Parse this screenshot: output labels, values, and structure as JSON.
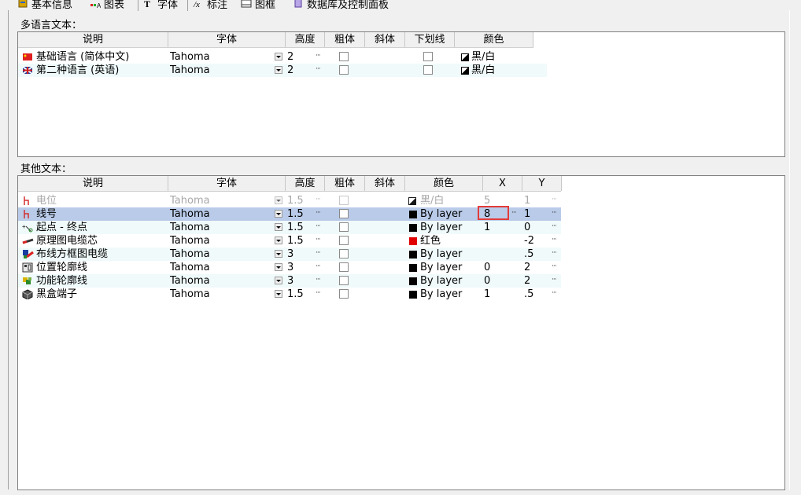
{
  "toolbar": {
    "items": [
      {
        "label": "基本信息",
        "icon": "basic-info-icon"
      },
      {
        "label": "图表",
        "icon": "chart-icon"
      },
      {
        "label": "字体",
        "icon": "font-icon"
      },
      {
        "label": "标注",
        "icon": "annotation-icon"
      },
      {
        "label": "图框",
        "icon": "frame-icon"
      },
      {
        "label": "数据库及控制面板",
        "icon": "database-icon"
      }
    ]
  },
  "multilang": {
    "section_title": "多语言文本：",
    "headers": [
      "说明",
      "字体",
      "高度",
      "粗体",
      "斜体",
      "下划线",
      "颜色"
    ],
    "rows": [
      {
        "desc": "基础语言 (简体中文)",
        "icon": "flag-china-icon",
        "font": "Tahoma",
        "height": "2",
        "color": "黑/白"
      },
      {
        "desc": "第二种语言 (英语)",
        "icon": "flag-uk-icon",
        "font": "Tahoma",
        "height": "2",
        "color": "黑/白"
      }
    ]
  },
  "other": {
    "section_title": "其他文本：",
    "headers": [
      "说明",
      "字体",
      "高度",
      "粗体",
      "斜体",
      "颜色",
      "X",
      "Y"
    ],
    "rows": [
      {
        "desc": "电位",
        "icon": "potential-icon",
        "font": "Tahoma",
        "height": "1.5",
        "color": "黑/白",
        "x": "5",
        "y": "1",
        "disabled": true
      },
      {
        "desc": "线号",
        "icon": "wire-number-icon",
        "font": "Tahoma",
        "height": "1.5",
        "color": "By layer",
        "x": "8",
        "y": "1",
        "selected": true
      },
      {
        "desc": "起点 - 终点",
        "icon": "start-end-icon",
        "font": "Tahoma",
        "height": "1.5",
        "color": "By layer",
        "x": "1",
        "y": "0"
      },
      {
        "desc": "原理图电缆芯",
        "icon": "cable-core-icon",
        "font": "Tahoma",
        "height": "1.5",
        "color": "红色",
        "x": "",
        "y": "-2"
      },
      {
        "desc": "布线方框图电缆",
        "icon": "wiring-cable-icon",
        "font": "Tahoma",
        "height": "3",
        "color": "By layer",
        "x": "",
        "y": ".5"
      },
      {
        "desc": "位置轮廓线",
        "icon": "location-outline-icon",
        "font": "Tahoma",
        "height": "3",
        "color": "By layer",
        "x": "0",
        "y": "2"
      },
      {
        "desc": "功能轮廓线",
        "icon": "function-outline-icon",
        "font": "Tahoma",
        "height": "3",
        "color": "By layer",
        "x": "0",
        "y": "2"
      },
      {
        "desc": "黑盒端子",
        "icon": "blackbox-terminal-icon",
        "font": "Tahoma",
        "height": "1.5",
        "color": "By layer",
        "x": "1",
        "y": ".5"
      }
    ]
  },
  "colors": {
    "selected_row": "#b9cbe8",
    "alt_row": "#f0fafa",
    "highlight_border": "#e23b3b",
    "red_swatch": "#e00000"
  }
}
